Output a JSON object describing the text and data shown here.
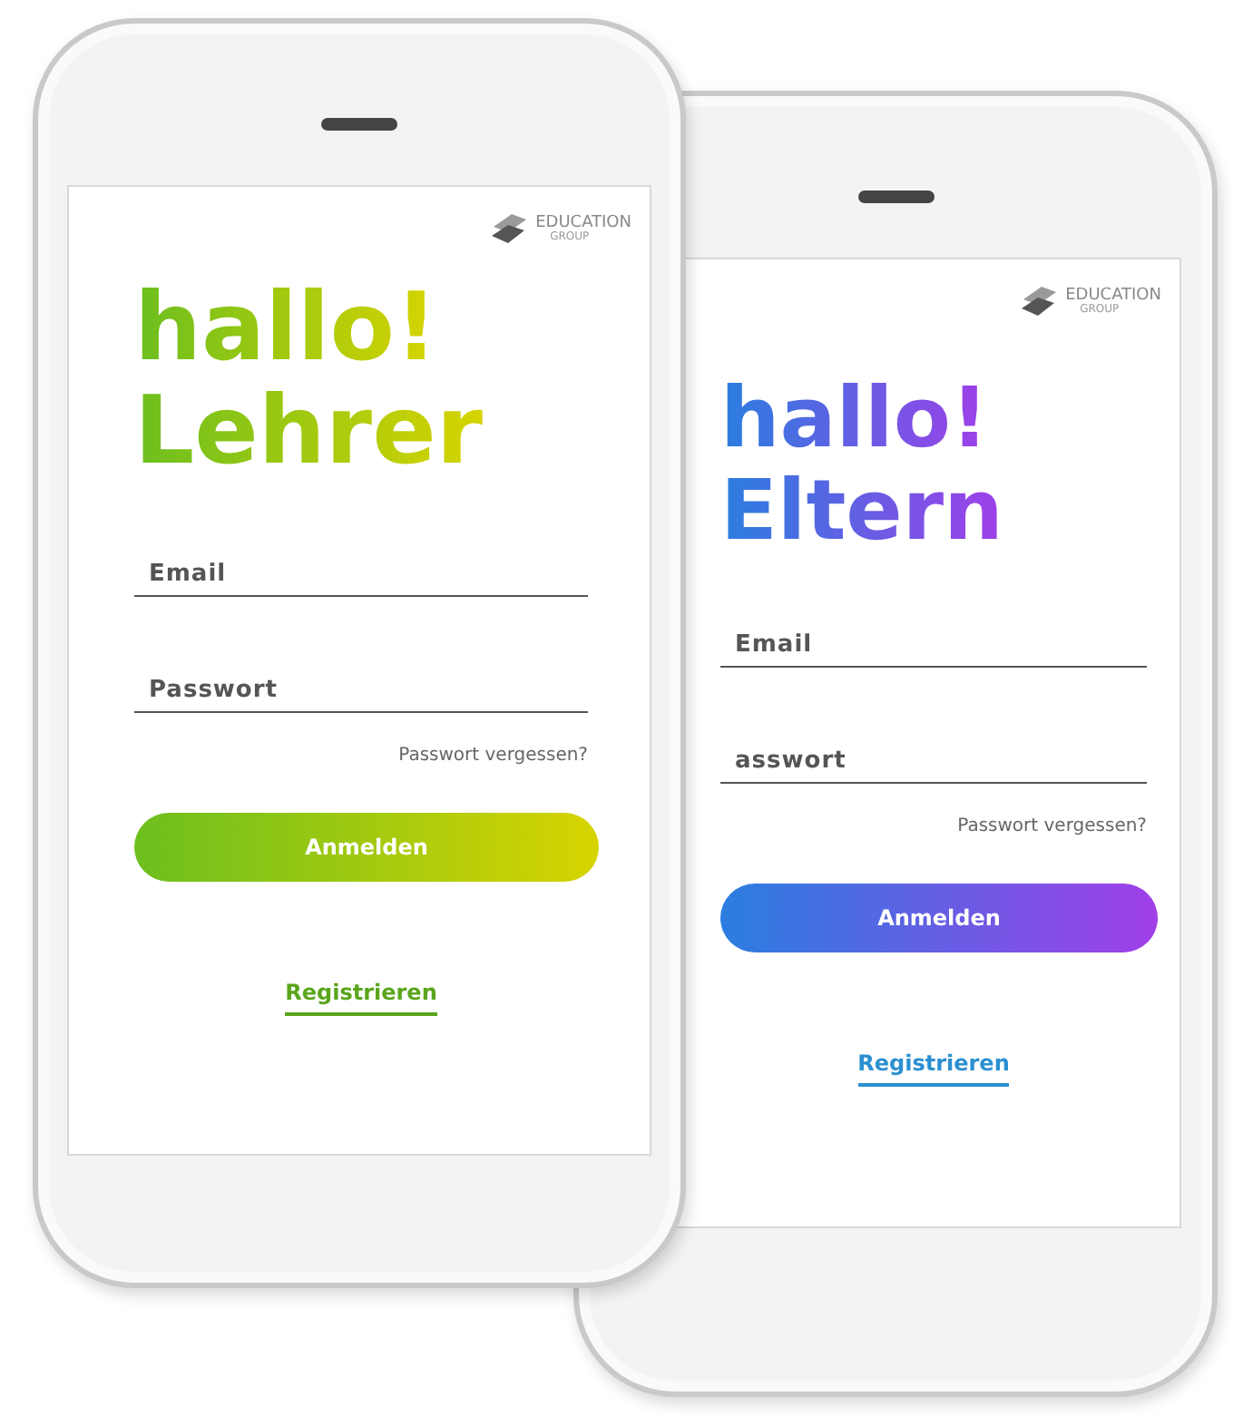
{
  "phones": [
    {
      "kind": "teacher",
      "logo": {
        "name": "EDUCATION",
        "sub": "GROUP"
      },
      "greeting": "hallo!",
      "audience": "Lehrer",
      "fields": [
        {
          "placeholder": "Email"
        },
        {
          "placeholder": "Passwort"
        }
      ],
      "forgot_link": "Passwort vergessen?",
      "login_button": "Anmelden",
      "register_link": "Registrieren"
    },
    {
      "kind": "parent",
      "logo": {
        "name": "EDUCATION",
        "sub": "GROUP"
      },
      "greeting": "hallo!",
      "audience": "Eltern",
      "fields": [
        {
          "placeholder": "Email"
        },
        {
          "placeholder": "asswort"
        }
      ],
      "forgot_link": "Passwort vergessen?",
      "login_button": "Anmelden",
      "register_link": "Registrieren"
    }
  ]
}
